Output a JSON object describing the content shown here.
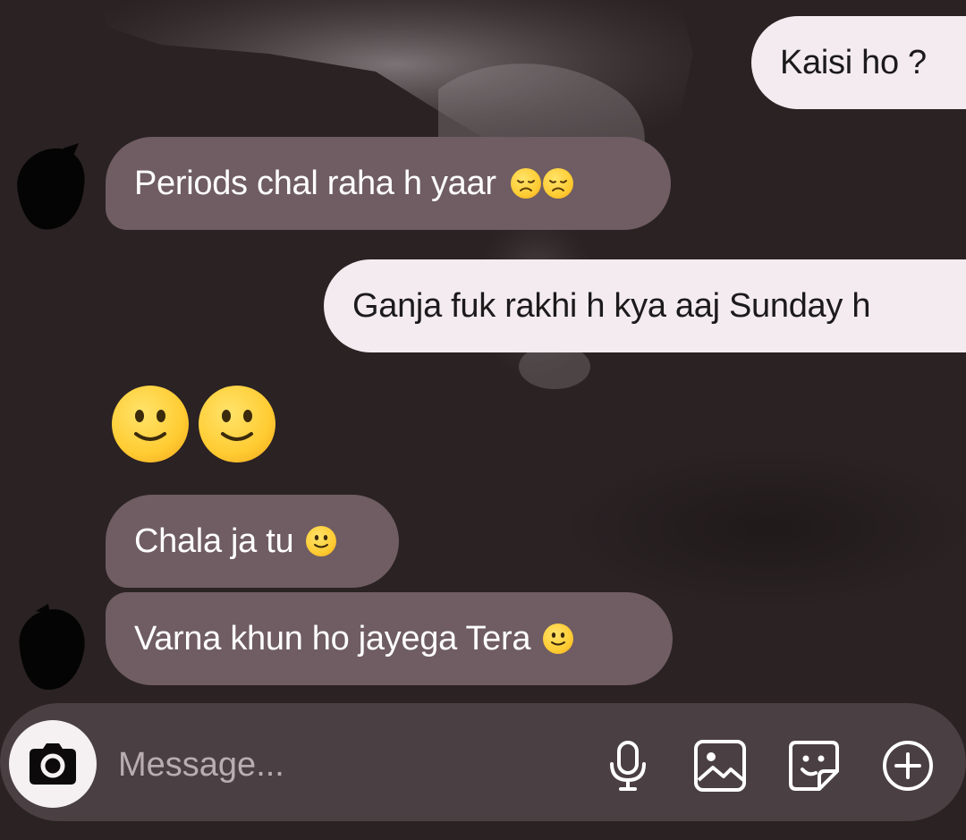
{
  "messages": [
    {
      "id": "m1",
      "direction": "outgoing",
      "text": "Kaisi ho ?"
    },
    {
      "id": "m2",
      "direction": "incoming",
      "text": "Periods chal raha h yaar",
      "emoji": [
        "disappointed-face",
        "disappointed-face"
      ]
    },
    {
      "id": "m3",
      "direction": "outgoing",
      "text": "Ganja fuk rakhi h kya aaj Sunday h"
    },
    {
      "id": "m4",
      "direction": "incoming",
      "emoji_only": [
        "slightly-smiling-face",
        "slightly-smiling-face"
      ]
    },
    {
      "id": "m5",
      "direction": "incoming",
      "text": "Chala ja tu",
      "emoji": [
        "slightly-smiling-face"
      ]
    },
    {
      "id": "m6",
      "direction": "incoming",
      "text": "Varna khun ho jayega Tera",
      "emoji": [
        "slightly-smiling-face"
      ]
    }
  ],
  "composer": {
    "placeholder": "Message...",
    "icons": [
      "camera-icon",
      "microphone-icon",
      "gallery-icon",
      "sticker-icon",
      "plus-circle-icon"
    ]
  },
  "colors": {
    "background": "#2a2223",
    "outgoing_bubble": "#f3ebef",
    "incoming_bubble": "#6f5d63",
    "composer_bar": "#4a3f42"
  }
}
